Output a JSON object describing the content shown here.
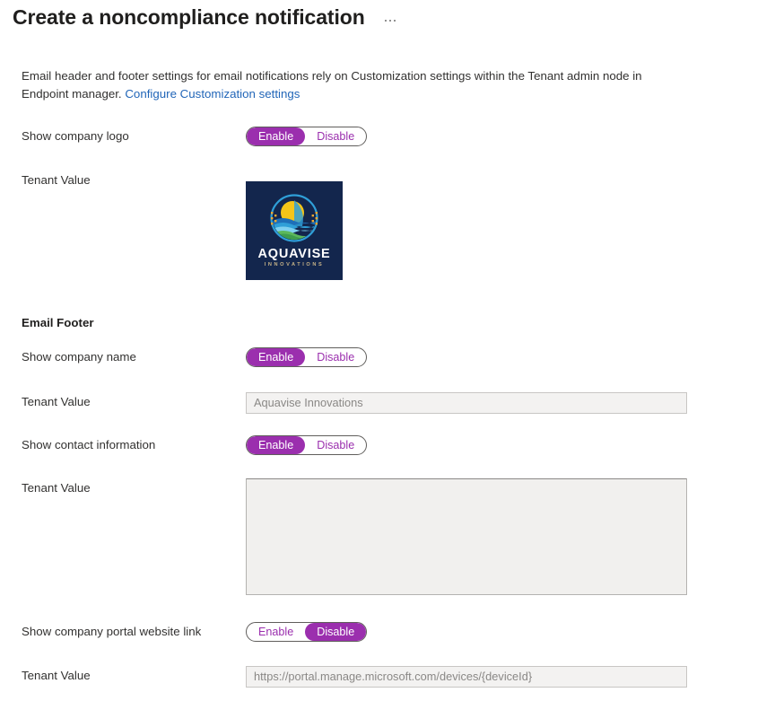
{
  "header": {
    "title": "Create a noncompliance notification",
    "more_menu_label": "More options"
  },
  "description": {
    "text_before_link": "Email header and footer settings for email notifications rely on Customization settings within the Tenant admin node in Endpoint manager. ",
    "link_text": "Configure Customization settings"
  },
  "toggle_options": {
    "enable": "Enable",
    "disable": "Disable"
  },
  "labels": {
    "tenant_value": "Tenant Value",
    "email_footer_heading": "Email Footer"
  },
  "rows": {
    "show_company_logo": {
      "label": "Show company logo",
      "selected": "Enable"
    },
    "show_company_name": {
      "label": "Show company name",
      "selected": "Enable",
      "tenant_value": "Aquavise Innovations"
    },
    "show_contact_information": {
      "label": "Show contact information",
      "selected": "Enable",
      "tenant_value": ""
    },
    "show_company_portal_website_link": {
      "label": "Show company portal website link",
      "selected": "Disable",
      "tenant_value": "https://portal.manage.microsoft.com/devices/{deviceId}"
    }
  },
  "company_logo": {
    "name": "AQUAVISE",
    "tagline": "INNOVATIONS",
    "background_color": "#13264d",
    "sun_color": "#f5c518",
    "wave_color": "#2f9fd8",
    "land_color": "#5cb85c",
    "accent_dot_color": "#f0a830"
  },
  "colors": {
    "accent_purple": "#9b2fae",
    "link_blue": "#2266b8",
    "text_primary": "#323130",
    "field_disabled_bg": "#f3f2f1"
  }
}
